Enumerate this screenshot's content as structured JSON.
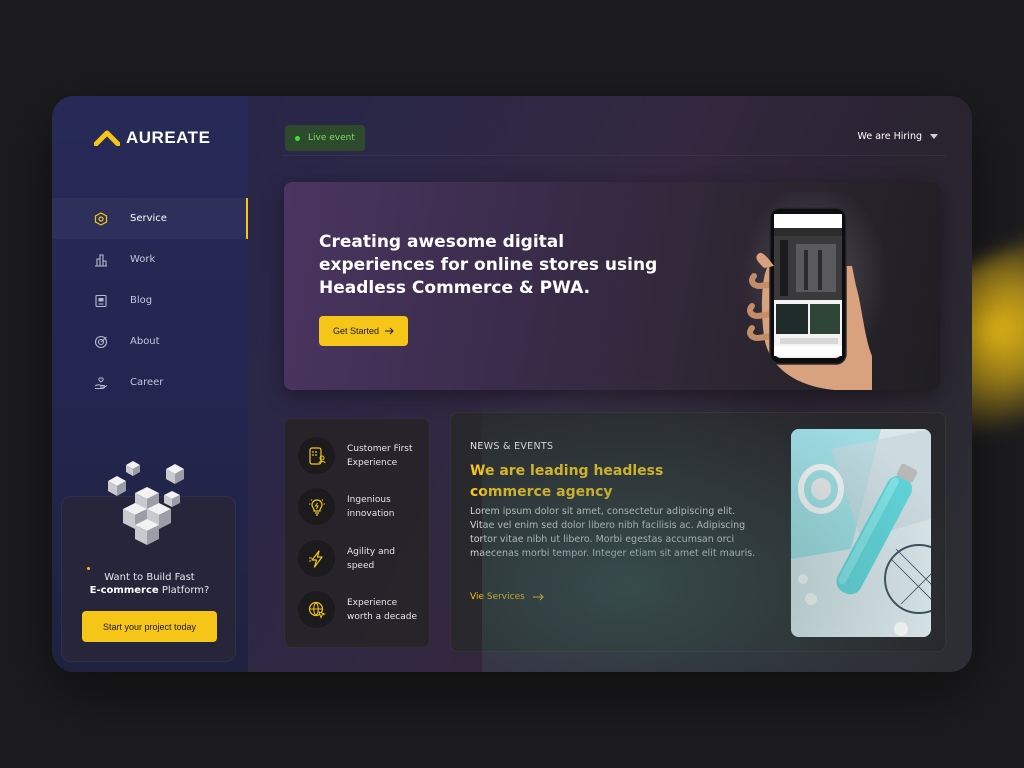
{
  "brand": {
    "name": "AUREATE"
  },
  "colors": {
    "accent": "#f5c518",
    "live": "#3be03b",
    "background": "#1c1c1e"
  },
  "sidebar": {
    "items": [
      {
        "label": "Service",
        "icon": "hexagon-icon",
        "active": true
      },
      {
        "label": "Work",
        "icon": "building-icon",
        "active": false
      },
      {
        "label": "Blog",
        "icon": "document-icon",
        "active": false
      },
      {
        "label": "About",
        "icon": "target-icon",
        "active": false
      },
      {
        "label": "Career",
        "icon": "hand-heart-icon",
        "active": false
      }
    ],
    "promo": {
      "line1": "Want to Build Fast",
      "line2_bold": "E-commerce",
      "line2_rest": " Platform?",
      "button": "Start your project today"
    }
  },
  "topbar": {
    "live_label": "Live event",
    "hiring_label": "We are Hiring"
  },
  "hero": {
    "title": "Creating awesome digital experiences for online stores using Headless Commerce & PWA.",
    "button": "Get Started"
  },
  "features": [
    {
      "label": "Customer First Experience",
      "icon": "customer-icon"
    },
    {
      "label": "Ingenious innovation",
      "icon": "lightbulb-icon"
    },
    {
      "label": "Agility and speed",
      "icon": "lightning-icon"
    },
    {
      "label": "Experience worth a decade",
      "icon": "globe-cursor-icon"
    }
  ],
  "news": {
    "tag": "NEWS & EVENTS",
    "title": "We are leading headless commerce agency",
    "body": "Lorem ipsum dolor sit amet, consectetur adipiscing elit. Vitae vel enim sed dolor libero nibh facilisis ac. Adipiscing tortor vitae nibh ut libero. Morbi egestas accumsan orci maecenas morbi tempor. Integer etiam sit amet elit mauris.",
    "link": "Vie Services"
  }
}
